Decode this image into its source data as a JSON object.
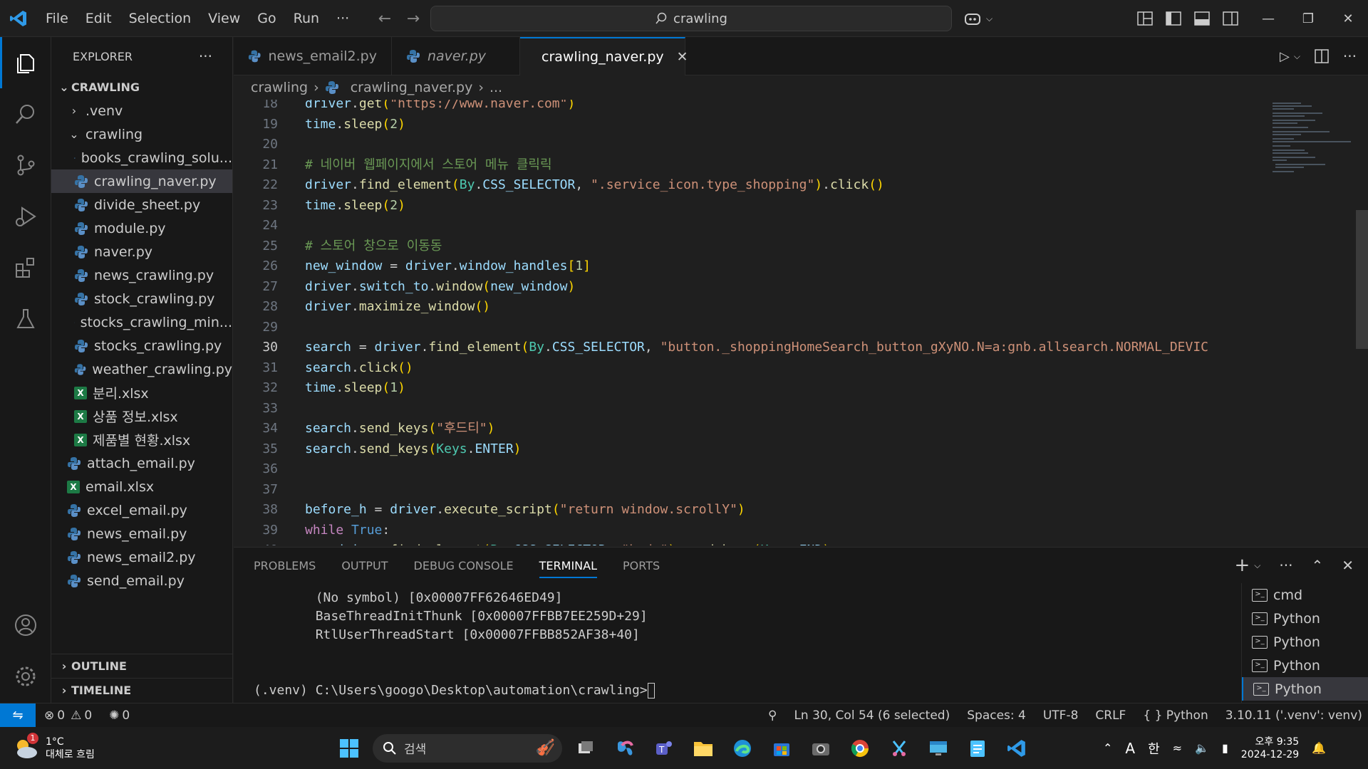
{
  "titlebar": {
    "menu": [
      "File",
      "Edit",
      "Selection",
      "View",
      "Go",
      "Run",
      "···"
    ],
    "search_text": "crawling"
  },
  "sidebar": {
    "title": "EXPLORER",
    "more": "···",
    "root": "CRAWLING",
    "items": [
      {
        "label": ".venv",
        "type": "folder",
        "level": 1,
        "open": false
      },
      {
        "label": "crawling",
        "type": "folder",
        "level": 1,
        "open": true
      },
      {
        "label": "books_crawling_solu...",
        "type": "py",
        "level": 2
      },
      {
        "label": "crawling_naver.py",
        "type": "py",
        "level": 2,
        "selected": true
      },
      {
        "label": "divide_sheet.py",
        "type": "py",
        "level": 2
      },
      {
        "label": "module.py",
        "type": "py",
        "level": 2
      },
      {
        "label": "naver.py",
        "type": "py",
        "level": 2
      },
      {
        "label": "news_crawling.py",
        "type": "py",
        "level": 2
      },
      {
        "label": "stock_crawling.py",
        "type": "py",
        "level": 2
      },
      {
        "label": "stocks_crawling_min...",
        "type": "py",
        "level": 2
      },
      {
        "label": "stocks_crawling.py",
        "type": "py",
        "level": 2
      },
      {
        "label": "weather_crawling.py",
        "type": "py",
        "level": 2
      },
      {
        "label": "분리.xlsx",
        "type": "xlsx",
        "level": 2
      },
      {
        "label": "상품 정보.xlsx",
        "type": "xlsx",
        "level": 2
      },
      {
        "label": "제품별 현황.xlsx",
        "type": "xlsx",
        "level": 2
      },
      {
        "label": "attach_email.py",
        "type": "py",
        "level": 1
      },
      {
        "label": "email.xlsx",
        "type": "xlsx",
        "level": 1
      },
      {
        "label": "excel_email.py",
        "type": "py",
        "level": 1
      },
      {
        "label": "news_email.py",
        "type": "py",
        "level": 1
      },
      {
        "label": "news_email2.py",
        "type": "py",
        "level": 1
      },
      {
        "label": "send_email.py",
        "type": "py",
        "level": 1
      }
    ],
    "outline": "OUTLINE",
    "timeline": "TIMELINE"
  },
  "tabs": [
    {
      "label": "news_email2.py",
      "active": false,
      "italic": false
    },
    {
      "label": "naver.py",
      "active": false,
      "italic": true
    },
    {
      "label": "crawling_naver.py",
      "active": true,
      "italic": false
    }
  ],
  "breadcrumb": {
    "folder": "crawling",
    "file": "crawling_naver.py",
    "more": "..."
  },
  "editor": {
    "current_line": 30,
    "lines": [
      {
        "n": 18,
        "tokens": [
          [
            "t-obj",
            "driver"
          ],
          [
            "t-p",
            "."
          ],
          [
            "t-fn",
            "get"
          ],
          [
            "t-br",
            "("
          ],
          [
            "t-str",
            "\"https://www.naver.com\""
          ],
          [
            "t-br",
            ")"
          ]
        ]
      },
      {
        "n": 19,
        "tokens": [
          [
            "t-obj",
            "time"
          ],
          [
            "t-p",
            "."
          ],
          [
            "t-fn",
            "sleep"
          ],
          [
            "t-br",
            "("
          ],
          [
            "t-num",
            "2"
          ],
          [
            "t-br",
            ")"
          ]
        ]
      },
      {
        "n": 20,
        "tokens": []
      },
      {
        "n": 21,
        "tokens": [
          [
            "t-cmt",
            "# 네이버 웹페이지에서 스토어 메뉴 클릭릭"
          ]
        ]
      },
      {
        "n": 22,
        "tokens": [
          [
            "t-obj",
            "driver"
          ],
          [
            "t-p",
            "."
          ],
          [
            "t-fn",
            "find_element"
          ],
          [
            "t-br",
            "("
          ],
          [
            "t-cls",
            "By"
          ],
          [
            "t-p",
            "."
          ],
          [
            "t-obj",
            "CSS_SELECTOR"
          ],
          [
            "t-p",
            ", "
          ],
          [
            "t-str",
            "\".service_icon.type_shopping\""
          ],
          [
            "t-br",
            ")"
          ],
          [
            "t-p",
            "."
          ],
          [
            "t-fn",
            "click"
          ],
          [
            "t-br",
            "()"
          ]
        ]
      },
      {
        "n": 23,
        "tokens": [
          [
            "t-obj",
            "time"
          ],
          [
            "t-p",
            "."
          ],
          [
            "t-fn",
            "sleep"
          ],
          [
            "t-br",
            "("
          ],
          [
            "t-num",
            "2"
          ],
          [
            "t-br",
            ")"
          ]
        ]
      },
      {
        "n": 24,
        "tokens": []
      },
      {
        "n": 25,
        "tokens": [
          [
            "t-cmt",
            "# 스토어 창으로 이동동"
          ]
        ]
      },
      {
        "n": 26,
        "tokens": [
          [
            "t-obj",
            "new_window"
          ],
          [
            "t-p",
            " = "
          ],
          [
            "t-obj",
            "driver"
          ],
          [
            "t-p",
            "."
          ],
          [
            "t-obj",
            "window_handles"
          ],
          [
            "t-br",
            "["
          ],
          [
            "t-num",
            "1"
          ],
          [
            "t-br",
            "]"
          ]
        ]
      },
      {
        "n": 27,
        "tokens": [
          [
            "t-obj",
            "driver"
          ],
          [
            "t-p",
            "."
          ],
          [
            "t-obj",
            "switch_to"
          ],
          [
            "t-p",
            "."
          ],
          [
            "t-fn",
            "window"
          ],
          [
            "t-br",
            "("
          ],
          [
            "t-obj",
            "new_window"
          ],
          [
            "t-br",
            ")"
          ]
        ]
      },
      {
        "n": 28,
        "tokens": [
          [
            "t-obj",
            "driver"
          ],
          [
            "t-p",
            "."
          ],
          [
            "t-fn",
            "maximize_window"
          ],
          [
            "t-br",
            "()"
          ]
        ]
      },
      {
        "n": 29,
        "tokens": []
      },
      {
        "n": 30,
        "tokens": [
          [
            "t-obj",
            "search"
          ],
          [
            "t-p",
            " = "
          ],
          [
            "t-obj",
            "driver"
          ],
          [
            "t-p",
            "."
          ],
          [
            "t-fn",
            "find_element"
          ],
          [
            "t-br",
            "("
          ],
          [
            "t-cls",
            "By"
          ],
          [
            "t-p",
            "."
          ],
          [
            "t-obj",
            "CSS_SELECTOR"
          ],
          [
            "t-p",
            ", "
          ],
          [
            "t-str",
            "\"button._shoppingHomeSearch_button_gXyNO.N=a:gnb.allsearch.NORMAL_DEVIC"
          ]
        ]
      },
      {
        "n": 31,
        "tokens": [
          [
            "t-obj",
            "search"
          ],
          [
            "t-p",
            "."
          ],
          [
            "t-fn",
            "click"
          ],
          [
            "t-br",
            "()"
          ]
        ]
      },
      {
        "n": 32,
        "tokens": [
          [
            "t-obj",
            "time"
          ],
          [
            "t-p",
            "."
          ],
          [
            "t-fn",
            "sleep"
          ],
          [
            "t-br",
            "("
          ],
          [
            "t-num",
            "1"
          ],
          [
            "t-br",
            ")"
          ]
        ]
      },
      {
        "n": 33,
        "tokens": []
      },
      {
        "n": 34,
        "tokens": [
          [
            "t-obj",
            "search"
          ],
          [
            "t-p",
            "."
          ],
          [
            "t-fn",
            "send_keys"
          ],
          [
            "t-br",
            "("
          ],
          [
            "t-str",
            "\"후드티\""
          ],
          [
            "t-br",
            ")"
          ]
        ]
      },
      {
        "n": 35,
        "tokens": [
          [
            "t-obj",
            "search"
          ],
          [
            "t-p",
            "."
          ],
          [
            "t-fn",
            "send_keys"
          ],
          [
            "t-br",
            "("
          ],
          [
            "t-cls",
            "Keys"
          ],
          [
            "t-p",
            "."
          ],
          [
            "t-obj",
            "ENTER"
          ],
          [
            "t-br",
            ")"
          ]
        ]
      },
      {
        "n": 36,
        "tokens": []
      },
      {
        "n": 37,
        "tokens": []
      },
      {
        "n": 38,
        "tokens": [
          [
            "t-obj",
            "before_h"
          ],
          [
            "t-p",
            " = "
          ],
          [
            "t-obj",
            "driver"
          ],
          [
            "t-p",
            "."
          ],
          [
            "t-fn",
            "execute_script"
          ],
          [
            "t-br",
            "("
          ],
          [
            "t-str",
            "\"return window.scrollY\""
          ],
          [
            "t-br",
            ")"
          ]
        ]
      },
      {
        "n": 39,
        "tokens": [
          [
            "t-kw",
            "while"
          ],
          [
            "t-p",
            " "
          ],
          [
            "t-const",
            "True"
          ],
          [
            "t-p",
            ":"
          ]
        ]
      },
      {
        "n": 40,
        "tokens": [
          [
            "t-p",
            "    "
          ],
          [
            "t-obj",
            "driver"
          ],
          [
            "t-p",
            "."
          ],
          [
            "t-fn",
            "find_element"
          ],
          [
            "t-br",
            "("
          ],
          [
            "t-cls",
            "By"
          ],
          [
            "t-p",
            "."
          ],
          [
            "t-obj",
            "CSS_SELECTOR"
          ],
          [
            "t-p",
            ", "
          ],
          [
            "t-str",
            "\"body\""
          ],
          [
            "t-br",
            ")"
          ],
          [
            "t-p",
            "."
          ],
          [
            "t-fn",
            "send_keys"
          ],
          [
            "t-br",
            "("
          ],
          [
            "t-cls",
            "Keys"
          ],
          [
            "t-p",
            "."
          ],
          [
            "t-obj",
            "END"
          ],
          [
            "t-br",
            ")"
          ]
        ]
      }
    ]
  },
  "panel": {
    "tabs": [
      "PROBLEMS",
      "OUTPUT",
      "DEBUG CONSOLE",
      "TERMINAL",
      "PORTS"
    ],
    "active_tab": "TERMINAL",
    "terminal_lines": [
      "        (No symbol) [0x00007FF62646ED49]",
      "        BaseThreadInitThunk [0x00007FFBB7EE259D+29]",
      "        RtlUserThreadStart [0x00007FFBB852AF38+40]",
      "",
      "",
      "(.venv) C:\\Users\\googo\\Desktop\\automation\\crawling>"
    ],
    "terminals": [
      "cmd",
      "Python",
      "Python",
      "Python",
      "Python"
    ]
  },
  "statusbar": {
    "errors": "0",
    "warnings": "0",
    "ports": "0",
    "position": "Ln 30, Col 54 (6 selected)",
    "spaces": "Spaces: 4",
    "encoding": "UTF-8",
    "eol": "CRLF",
    "language": "Python",
    "interpreter": "3.10.11 ('.venv': venv)"
  },
  "taskbar": {
    "weather_temp": "1°C",
    "weather_desc": "대체로 흐림",
    "weather_badge": "1",
    "search_placeholder": "검색",
    "tray_lang_a": "A",
    "tray_lang_ko": "한",
    "time": "오후 9:35",
    "date": "2024-12-29"
  },
  "colors": {
    "accent": "#0078d4",
    "editor_bg": "#1f1f1f",
    "sidebar_bg": "#181818"
  }
}
